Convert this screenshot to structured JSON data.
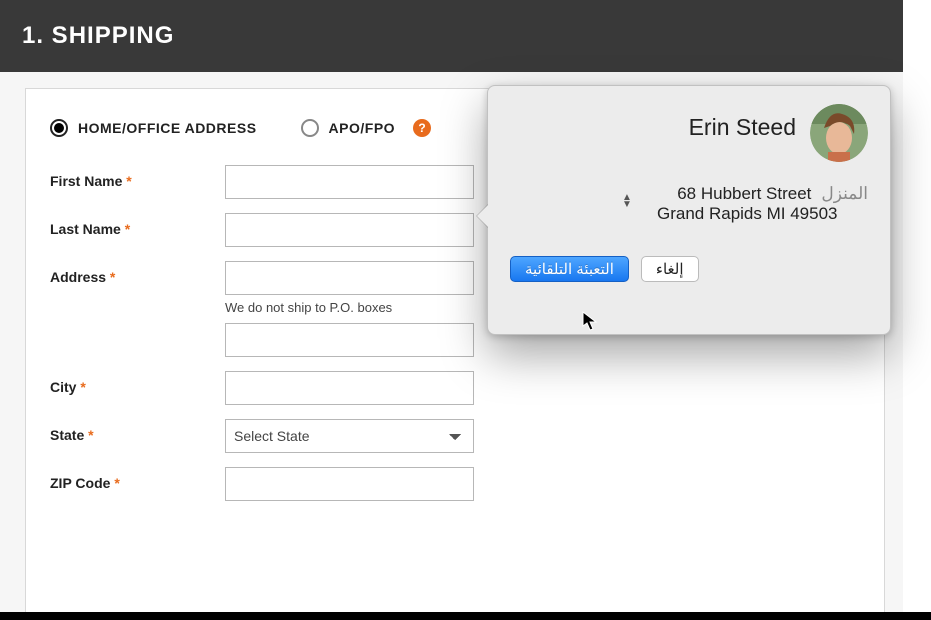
{
  "header": {
    "title": "1. SHIPPING"
  },
  "address_type": {
    "home_label": "HOME/OFFICE ADDRESS",
    "apo_label": "APO/FPO",
    "help_icon": "?"
  },
  "form": {
    "first_name_label": "First Name",
    "last_name_label": "Last Name",
    "address_label": "Address",
    "address_helper": "We do not ship to P.O. boxes",
    "city_label": "City",
    "state_label": "State",
    "state_placeholder": "Select State",
    "zip_label": "ZIP Code",
    "required_marker": "*"
  },
  "autofill": {
    "contact_name": "Erin Steed",
    "address_tag": "المنزل",
    "address_line1": "68 Hubbert Street",
    "address_line2": "Grand Rapids MI 49503",
    "primary_button": "التعبئة التلقائية",
    "secondary_button": "إلغاء"
  }
}
